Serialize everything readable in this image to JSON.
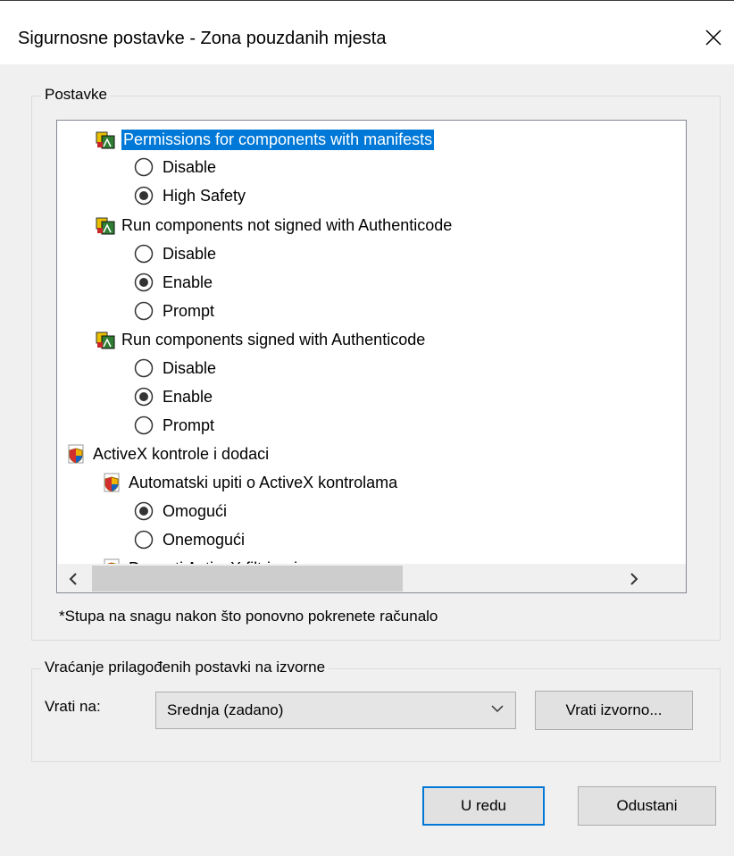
{
  "window": {
    "title": "Sigurnosne postavke - Zona pouzdanih mjesta",
    "close_icon": "close-icon"
  },
  "settings_group": {
    "legend": "Postavke",
    "items": [
      {
        "kind": "heading",
        "icon": "component-icon",
        "label": "Permissions for components with manifests",
        "selected": true
      },
      {
        "kind": "radio",
        "label": "Disable",
        "checked": false
      },
      {
        "kind": "radio",
        "label": "High Safety",
        "checked": true
      },
      {
        "kind": "heading",
        "icon": "component-icon",
        "label": "Run components not signed with Authenticode",
        "selected": false
      },
      {
        "kind": "radio",
        "label": "Disable",
        "checked": false
      },
      {
        "kind": "radio",
        "label": "Enable",
        "checked": true
      },
      {
        "kind": "radio",
        "label": "Prompt",
        "checked": false
      },
      {
        "kind": "heading",
        "icon": "component-icon",
        "label": "Run components signed with Authenticode",
        "selected": false
      },
      {
        "kind": "radio",
        "label": "Disable",
        "checked": false
      },
      {
        "kind": "radio",
        "label": "Enable",
        "checked": true
      },
      {
        "kind": "radio",
        "label": "Prompt",
        "checked": false
      },
      {
        "kind": "category",
        "icon": "shield-icon",
        "label": "ActiveX kontrole i dodaci"
      },
      {
        "kind": "subheading",
        "icon": "shield-icon",
        "label": "Automatski upiti o ActiveX kontrolama"
      },
      {
        "kind": "radio",
        "label": "Omogući",
        "checked": true
      },
      {
        "kind": "radio",
        "label": "Onemogući",
        "checked": false
      },
      {
        "kind": "subheading",
        "icon": "shield-icon",
        "label": "Dopusti ActiveX filtriranje"
      }
    ],
    "note": "*Stupa na snagu nakon što ponovno pokrenete računalo"
  },
  "reset_group": {
    "legend": "Vraćanje prilagođenih postavki na izvorne",
    "reset_to_label": "Vrati na:",
    "reset_level": "Srednja (zadano)",
    "reset_button": "Vrati izvorno..."
  },
  "footer": {
    "ok_button": "U redu",
    "cancel_button": "Odustani"
  }
}
